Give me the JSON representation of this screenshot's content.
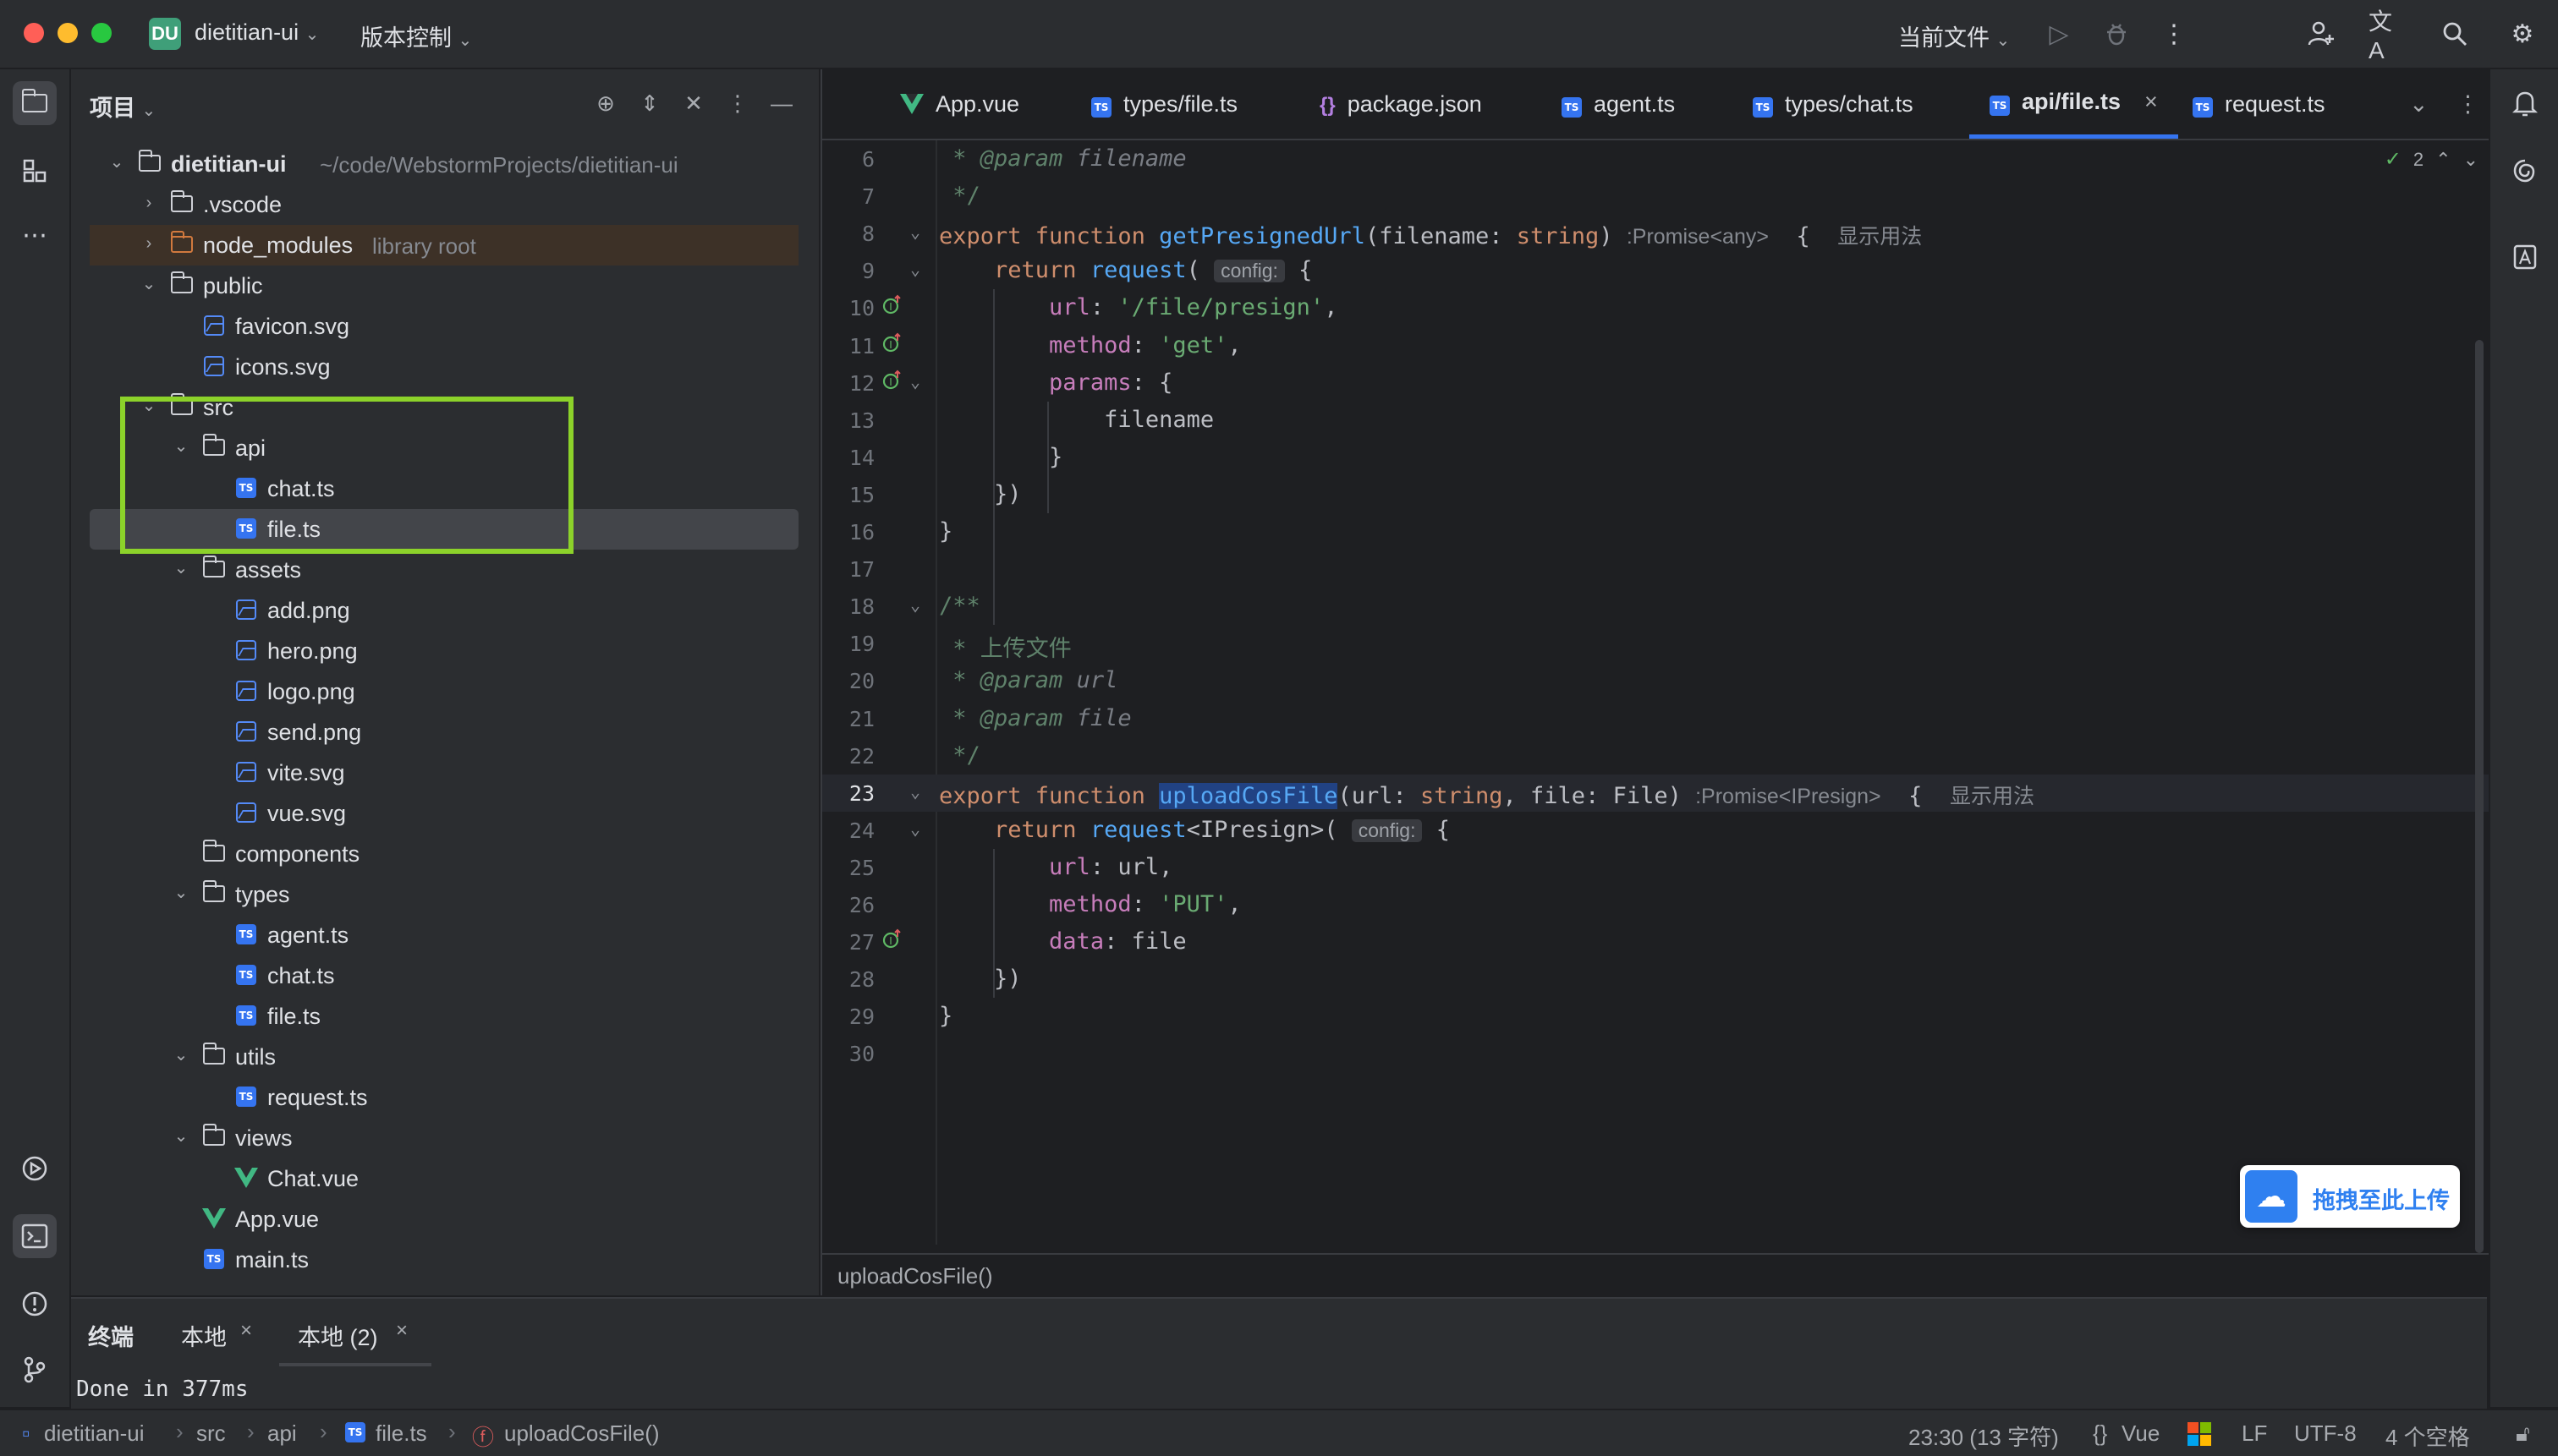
{
  "titlebar": {
    "project_badge": "DU",
    "project_name": "dietitian-ui",
    "vcs_menu": "版本控制",
    "run_config": "当前文件"
  },
  "project_panel": {
    "title": "项目",
    "tree": [
      {
        "name": "dietitian-ui",
        "hint": "~/code/WebstormProjects/dietitian-ui",
        "type": "folder",
        "level": 0,
        "expanded": true
      },
      {
        "name": ".vscode",
        "type": "folder",
        "level": 1,
        "expanded": false
      },
      {
        "name": "node_modules",
        "hint": "library root",
        "type": "folder-excluded",
        "level": 1,
        "expanded": false
      },
      {
        "name": "public",
        "type": "folder",
        "level": 1,
        "expanded": true
      },
      {
        "name": "favicon.svg",
        "type": "image",
        "level": 2
      },
      {
        "name": "icons.svg",
        "type": "image",
        "level": 2
      },
      {
        "name": "src",
        "type": "folder",
        "level": 1,
        "expanded": true
      },
      {
        "name": "api",
        "type": "folder",
        "level": 2,
        "expanded": true
      },
      {
        "name": "chat.ts",
        "type": "ts",
        "level": 3
      },
      {
        "name": "file.ts",
        "type": "ts",
        "level": 3,
        "selected": true
      },
      {
        "name": "assets",
        "type": "folder",
        "level": 2,
        "expanded": true
      },
      {
        "name": "add.png",
        "type": "image",
        "level": 3
      },
      {
        "name": "hero.png",
        "type": "image",
        "level": 3
      },
      {
        "name": "logo.png",
        "type": "image",
        "level": 3
      },
      {
        "name": "send.png",
        "type": "image",
        "level": 3
      },
      {
        "name": "vite.svg",
        "type": "image",
        "level": 3
      },
      {
        "name": "vue.svg",
        "type": "image",
        "level": 3
      },
      {
        "name": "components",
        "type": "folder",
        "level": 2
      },
      {
        "name": "types",
        "type": "folder",
        "level": 2,
        "expanded": true
      },
      {
        "name": "agent.ts",
        "type": "ts",
        "level": 3
      },
      {
        "name": "chat.ts",
        "type": "ts",
        "level": 3
      },
      {
        "name": "file.ts",
        "type": "ts",
        "level": 3
      },
      {
        "name": "utils",
        "type": "folder",
        "level": 2,
        "expanded": true
      },
      {
        "name": "request.ts",
        "type": "ts",
        "level": 3
      },
      {
        "name": "views",
        "type": "folder",
        "level": 2,
        "expanded": true
      },
      {
        "name": "Chat.vue",
        "type": "vue",
        "level": 3
      },
      {
        "name": "App.vue",
        "type": "vue",
        "level": 2
      },
      {
        "name": "main.ts",
        "type": "ts",
        "level": 2
      }
    ]
  },
  "editor": {
    "tabs": [
      {
        "label": "App.vue",
        "type": "vue"
      },
      {
        "label": "types/file.ts",
        "type": "ts"
      },
      {
        "label": "package.json",
        "type": "json"
      },
      {
        "label": "agent.ts",
        "type": "ts"
      },
      {
        "label": "types/chat.ts",
        "type": "ts"
      },
      {
        "label": "api/file.ts",
        "type": "ts",
        "active": true
      },
      {
        "label": "request.ts",
        "type": "ts"
      }
    ],
    "inspection_count": "2",
    "current_line": 23,
    "lines": [
      {
        "n": "6",
        "html": " <span class='tag'>* @param</span> <span class='cmi'>filename</span>"
      },
      {
        "n": "7",
        "html": " <span class='cmt'>*/</span>"
      },
      {
        "n": "8",
        "fold": true,
        "html": "<span class='kw'>export function</span> <span class='fn'>getPresignedUrl</span>(filename: <span class='kw'>string</span>) <span class='hint-gray'>:Promise&lt;any&gt;</span>  {  <span class='hint-gray'>显示用法</span>"
      },
      {
        "n": "9",
        "fold": true,
        "html": "    <span class='kw'>return</span> <span class='fn'>request</span>( <span class='inlay'>config:</span> {"
      },
      {
        "n": "10",
        "gut": true,
        "html": "        <span class='prop'>url</span>: <span class='str'>'/file/presign'</span>,"
      },
      {
        "n": "11",
        "gut": true,
        "html": "        <span class='prop'>method</span>: <span class='str'>'get'</span>,"
      },
      {
        "n": "12",
        "gut": true,
        "fold": true,
        "html": "        <span class='prop'>params</span>: {"
      },
      {
        "n": "13",
        "html": "            filename"
      },
      {
        "n": "14",
        "html": "        }"
      },
      {
        "n": "15",
        "html": "    })"
      },
      {
        "n": "16",
        "html": "}"
      },
      {
        "n": "17",
        "html": ""
      },
      {
        "n": "18",
        "fold": true,
        "html": "<span class='cmt'>/**</span>"
      },
      {
        "n": "19",
        "html": " <span class='cmt'>* 上传文件</span>"
      },
      {
        "n": "20",
        "html": " <span class='tag'>* @param</span> <span class='cmi'>url</span>"
      },
      {
        "n": "21",
        "html": " <span class='tag'>* @param</span> <span class='cmi'>file</span>"
      },
      {
        "n": "22",
        "html": " <span class='cmt'>*/</span>"
      },
      {
        "n": "23",
        "fold": true,
        "html": "<span class='kw'>export function</span> <span class='fn hl'>uploadCosFile</span>(url: <span class='kw'>string</span>, file: File) <span class='hint-gray'>:Promise&lt;IPresign&gt;</span>  {  <span class='hint-gray'>显示用法</span>"
      },
      {
        "n": "24",
        "fold": true,
        "html": "    <span class='kw'>return</span> <span class='fn'>request</span>&lt;IPresign&gt;( <span class='inlay'>config:</span> {"
      },
      {
        "n": "25",
        "html": "        <span class='prop'>url</span>: url,"
      },
      {
        "n": "26",
        "html": "        <span class='prop'>method</span>: <span class='str'>'PUT'</span>,"
      },
      {
        "n": "27",
        "gut": true,
        "html": "        <span class='prop'>data</span>: file"
      },
      {
        "n": "28",
        "html": "    })"
      },
      {
        "n": "29",
        "html": "}"
      },
      {
        "n": "30",
        "html": ""
      }
    ],
    "breadcrumb_fn": "uploadCosFile()"
  },
  "upload_widget": {
    "label": "拖拽至此上传"
  },
  "terminal": {
    "title": "终端",
    "tabs": [
      {
        "label": "本地"
      },
      {
        "label": "本地 (2)",
        "active": true
      }
    ],
    "output": "Done in 377ms"
  },
  "statusbar": {
    "path": [
      "dietitian-ui",
      "src",
      "api",
      "file.ts",
      "uploadCosFile()"
    ],
    "cursor": "23:30 (13 字符)",
    "language": "Vue",
    "line_ending": "LF",
    "encoding": "UTF-8",
    "indent": "4 个空格"
  },
  "colors": {
    "accent": "#3574f0",
    "highlight_box": "#8cd22a",
    "vue_green": "#41b883"
  }
}
